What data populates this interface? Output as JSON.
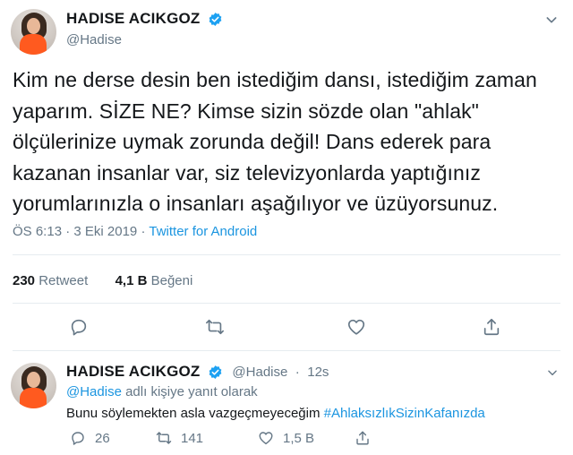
{
  "main_tweet": {
    "display_name": "HADISE ACIKGOZ",
    "handle": "@Hadise",
    "text": "Kim ne derse desin ben istediğim dansı, istediğim zaman yaparım. SİZE NE? Kimse sizin sözde olan \"ahlak\" ölçülerinize uymak zorunda değil! Dans ederek para kazanan insanlar var, siz televizyonlarda yaptığınız yorumlarınızla o insanları aşağılıyor ve üzüyorsunuz.",
    "time": "ÖS 6:13",
    "date": "3 Eki 2019",
    "separator": "·",
    "source": "Twitter for Android",
    "retweet_count": "230",
    "retweet_label": "Retweet",
    "like_count": "4,1 B",
    "like_label": "Beğeni"
  },
  "reply_tweet": {
    "display_name": "HADISE ACIKGOZ",
    "handle": "@Hadise",
    "separator": "·",
    "age": "12s",
    "replying_mention": "@Hadise",
    "replying_suffix": "adlı kişiye yanıt olarak",
    "text": "Bunu söylemekten asla vazgeçmeyeceğim",
    "hashtag": "#AhlaksızlıkSizinKafanızda",
    "reply_count": "26",
    "retweet_count": "141",
    "like_count": "1,5 B"
  },
  "icons": {
    "verified": "verified-badge-icon",
    "caret": "chevron-down-icon",
    "reply": "reply-icon",
    "retweet": "retweet-icon",
    "like": "heart-icon",
    "share": "share-icon"
  },
  "colors": {
    "link": "#1b95e0",
    "secondary": "#657786",
    "divider": "#e6ecf0",
    "verified": "#1da1f2"
  }
}
